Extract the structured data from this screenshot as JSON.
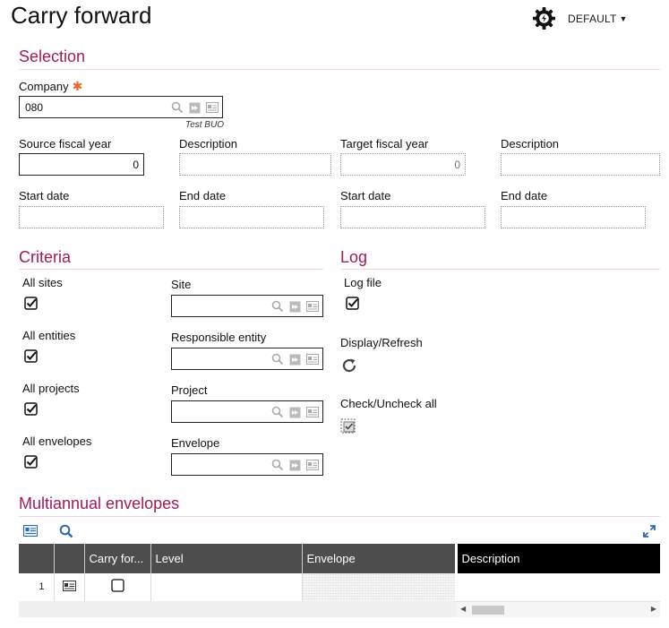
{
  "header": {
    "title": "Carry forward",
    "profile_label": "DEFAULT"
  },
  "selection": {
    "title": "Selection",
    "company": {
      "label": "Company",
      "value": "080",
      "subtext": "Test BUO"
    },
    "source_fiscal_year": {
      "label": "Source fiscal year",
      "value": "0"
    },
    "source_description": {
      "label": "Description",
      "value": ""
    },
    "target_fiscal_year": {
      "label": "Target fiscal year",
      "value": "0"
    },
    "target_description": {
      "label": "Description",
      "value": ""
    },
    "start_date_1": {
      "label": "Start date",
      "value": ""
    },
    "end_date_1": {
      "label": "End date",
      "value": ""
    },
    "start_date_2": {
      "label": "Start date",
      "value": ""
    },
    "end_date_2": {
      "label": "End date",
      "value": ""
    }
  },
  "criteria": {
    "title": "Criteria",
    "all_sites": {
      "label": "All sites",
      "checked": true
    },
    "site": {
      "label": "Site",
      "value": ""
    },
    "all_entities": {
      "label": "All entities",
      "checked": true
    },
    "responsible_entity": {
      "label": "Responsible entity",
      "value": ""
    },
    "all_projects": {
      "label": "All projects",
      "checked": true
    },
    "project": {
      "label": "Project",
      "value": ""
    },
    "all_envelopes": {
      "label": "All envelopes",
      "checked": true
    },
    "envelope": {
      "label": "Envelope",
      "value": ""
    }
  },
  "log": {
    "title": "Log",
    "log_file": {
      "label": "Log file",
      "checked": true
    },
    "display_refresh": {
      "label": "Display/Refresh"
    },
    "check_uncheck_all": {
      "label": "Check/Uncheck all"
    }
  },
  "multiannual": {
    "title": "Multiannual envelopes",
    "columns": [
      "Carry for...",
      "Level",
      "Envelope",
      "Description"
    ],
    "rows": [
      {
        "num": "1",
        "carry_forward": false,
        "level": "",
        "envelope": "",
        "description": ""
      }
    ]
  },
  "colors": {
    "accent": "#a2195c",
    "required": "#e8682e",
    "header_bg": "#4d4d4d",
    "icon_blue": "#2a6ab5"
  }
}
